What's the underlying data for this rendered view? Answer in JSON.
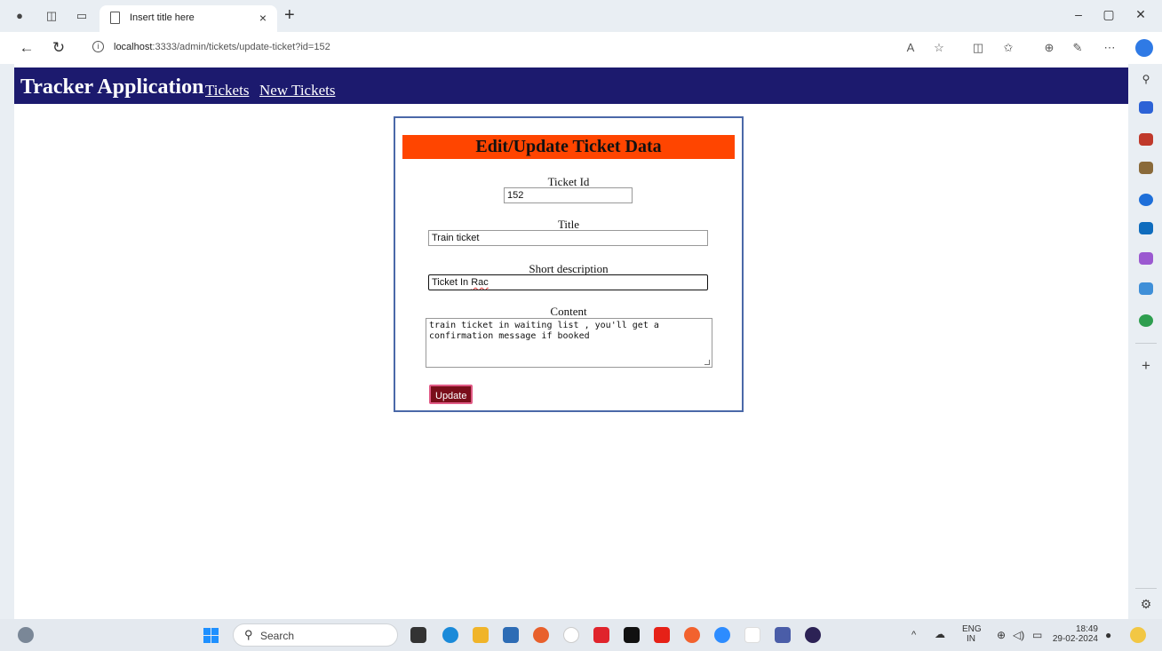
{
  "browser": {
    "tab_title": "Insert title here",
    "tab_close": "×",
    "new_tab": "+",
    "window_controls": {
      "minimize": "–",
      "restore": "▢",
      "close": "✕"
    },
    "url_host": "localhost",
    "url_rest": ":3333/admin/tickets/update-ticket?id=152",
    "icons": [
      "profile-icon",
      "workspaces-icon",
      "tab-actions-icon",
      "back-icon",
      "refresh-icon",
      "info-icon",
      "read-aloud-icon",
      "favorite-icon",
      "split-screen-icon",
      "favorites-icon",
      "collections-icon",
      "extensions-icon",
      "more-icon"
    ]
  },
  "header": {
    "brand": "Tracker Application",
    "links": [
      "Tickets",
      "New Tickets"
    ]
  },
  "form": {
    "heading": "Edit/Update Ticket Data",
    "ticket_id_label": "Ticket Id",
    "ticket_id_value": "152",
    "title_label": "Title",
    "title_value": "Train ticket",
    "short_desc_label": "Short description",
    "short_desc_value_a": "Ticket In ",
    "short_desc_value_b": "Rac",
    "content_label": "Content",
    "content_value": "train ticket in waiting list , you'll get a\nconfirmation message if booked",
    "update_button": "Update"
  },
  "taskbar": {
    "search_placeholder": "Search",
    "lang_top": "ENG",
    "lang_bottom": "IN",
    "time": "18:49",
    "date": "29-02-2024"
  },
  "colors": {
    "header_bg": "#1c1a6e",
    "form_heading_bg": "#ff4500",
    "update_button_bg": "#7a0e1a",
    "card_border": "#4a68a8"
  }
}
